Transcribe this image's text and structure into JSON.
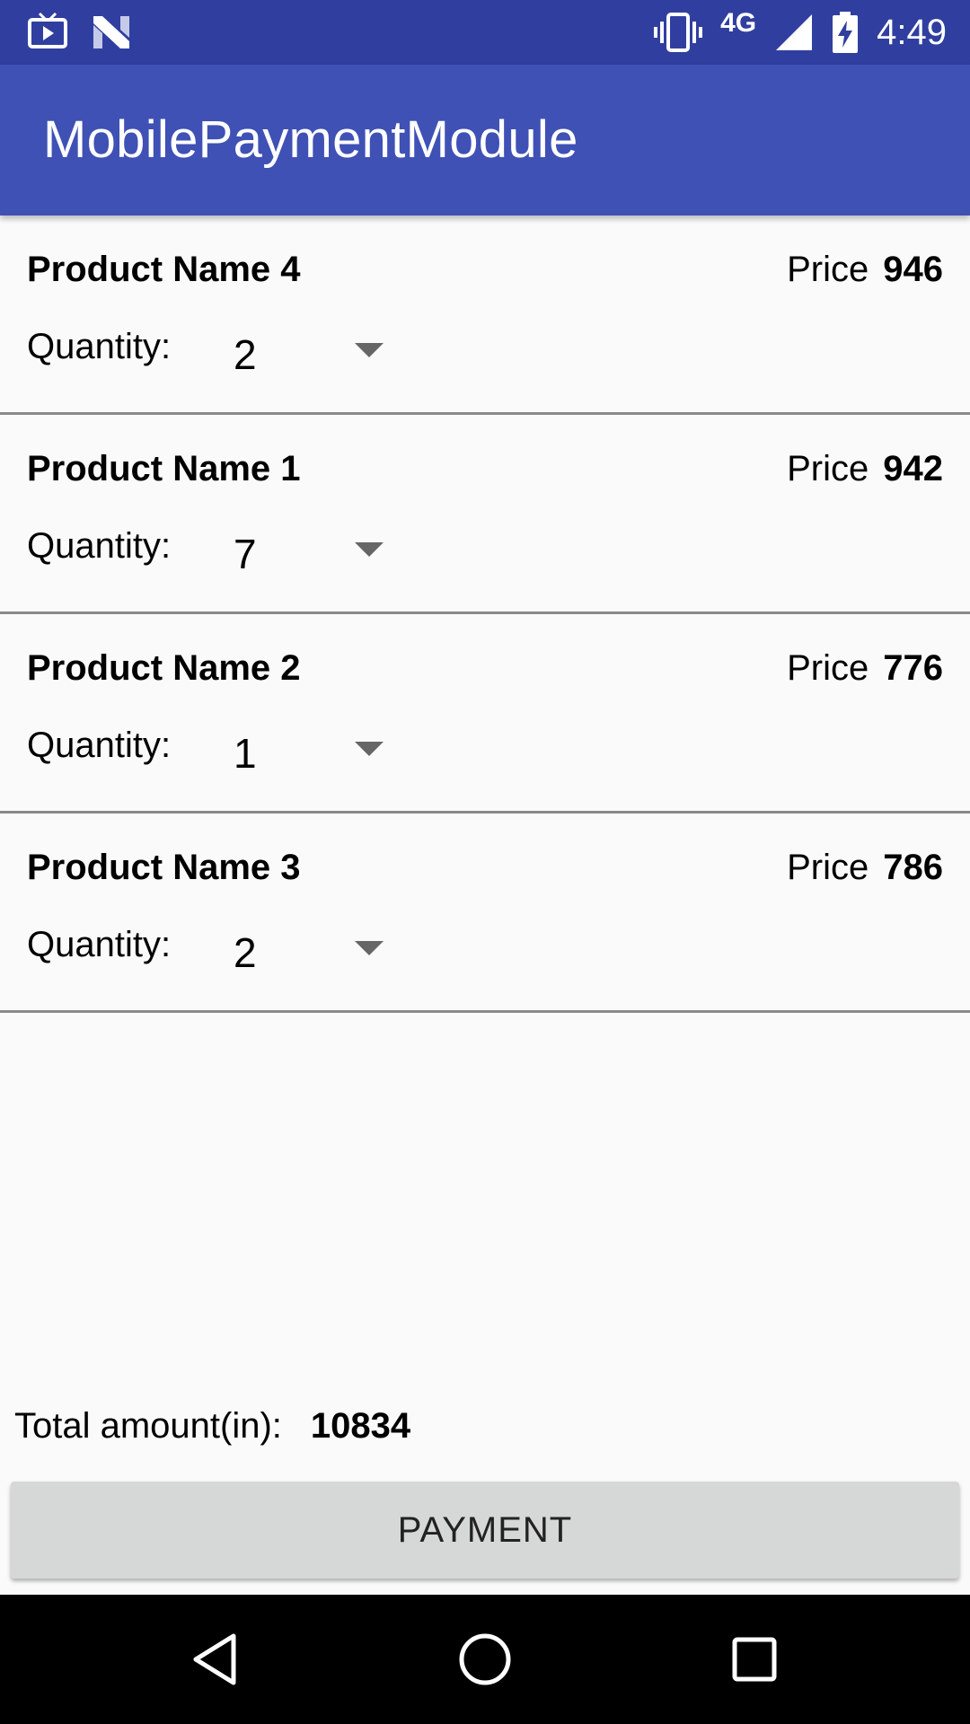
{
  "status_bar": {
    "network": "4G",
    "time": "4:49",
    "icons": [
      "tv-icon",
      "n-icon",
      "vibrate-icon",
      "signal-icon",
      "battery-charging-icon"
    ]
  },
  "app_bar": {
    "title": "MobilePaymentModule"
  },
  "products": [
    {
      "name": "Product Name 4",
      "price_label": "Price",
      "price": "946",
      "quantity_label": "Quantity:",
      "quantity": "2"
    },
    {
      "name": "Product Name 1",
      "price_label": "Price",
      "price": "942",
      "quantity_label": "Quantity:",
      "quantity": "7"
    },
    {
      "name": "Product Name 2",
      "price_label": "Price",
      "price": "776",
      "quantity_label": "Quantity:",
      "quantity": "1"
    },
    {
      "name": "Product Name 3",
      "price_label": "Price",
      "price": "786",
      "quantity_label": "Quantity:",
      "quantity": "2"
    }
  ],
  "total": {
    "label": "Total amount(in):",
    "value": "10834"
  },
  "payment_button": {
    "label": "PAYMENT"
  },
  "nav_bar": {
    "icons": [
      "back-icon",
      "home-icon",
      "recents-icon"
    ]
  },
  "colors": {
    "status_bar": "#303f9f",
    "app_bar": "#3f51b5",
    "background": "#fafafa",
    "button": "#d6d7d7"
  }
}
